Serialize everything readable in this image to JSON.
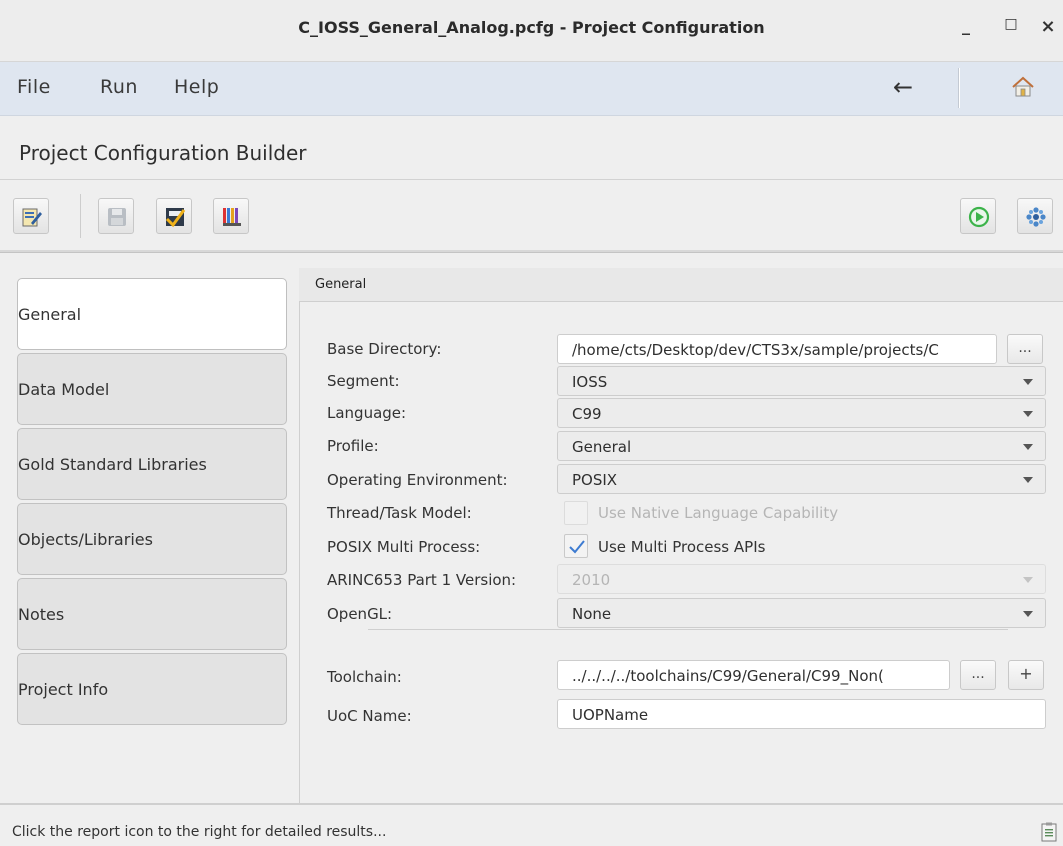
{
  "window": {
    "title": "C_IOSS_General_Analog.pcfg - Project Configuration",
    "minimize_label": "_",
    "maximize_label": "□",
    "close_label": "×"
  },
  "menu": {
    "file": "File",
    "run": "Run",
    "help": "Help",
    "back_glyph": "←"
  },
  "heading": "Project Configuration Builder",
  "toolbar": {
    "left_icons": [
      "edit-config-icon",
      "save-icon",
      "validate-icon",
      "report-columns-icon"
    ],
    "right_icons": [
      "run-icon",
      "settings-icon"
    ],
    "run_color": "#3cb34a"
  },
  "tabs": [
    {
      "label": "General",
      "active": true
    },
    {
      "label": "Data Model",
      "active": false
    },
    {
      "label": "Gold Standard Libraries",
      "active": false
    },
    {
      "label": "Objects/Libraries",
      "active": false
    },
    {
      "label": "Notes",
      "active": false
    },
    {
      "label": "Project Info",
      "active": false
    }
  ],
  "panel": {
    "header": "General",
    "fields": {
      "base_directory": {
        "label": "Base Directory:",
        "value": "/home/cts/Desktop/dev/CTS3x/sample/projects/C",
        "browse": "..."
      },
      "segment": {
        "label": "Segment:",
        "value": "IOSS"
      },
      "language": {
        "label": "Language:",
        "value": "C99"
      },
      "profile": {
        "label": "Profile:",
        "value": "General"
      },
      "operating_environment": {
        "label": "Operating Environment:",
        "value": "POSIX"
      },
      "thread_task_model": {
        "label": "Thread/Task Model:",
        "checkbox_label": "Use Native Language Capability",
        "checked": false,
        "enabled": false
      },
      "posix_multi_process": {
        "label": "POSIX Multi Process:",
        "checkbox_label": "Use Multi Process APIs",
        "checked": true,
        "enabled": true
      },
      "arinc653_version": {
        "label": "ARINC653 Part 1 Version:",
        "value": "2010",
        "enabled": false
      },
      "opengl": {
        "label": "OpenGL:",
        "value": "None"
      },
      "toolchain": {
        "label": "Toolchain:",
        "value": "../../../../toolchains/C99/General/C99_Non(",
        "browse": "...",
        "add": "+"
      },
      "uoc_name": {
        "label": "UoC Name:",
        "value": "UOPName"
      }
    }
  },
  "status": {
    "message": "Click the report icon to the right for detailed results..."
  }
}
